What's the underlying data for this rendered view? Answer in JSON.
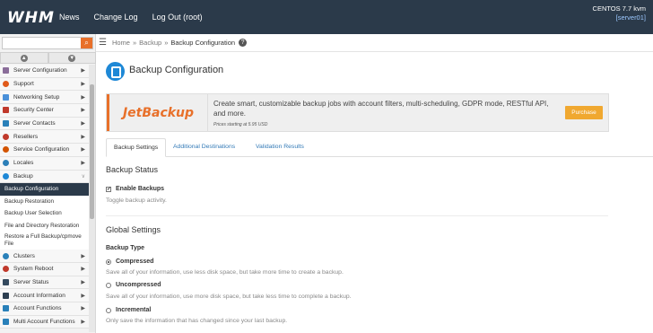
{
  "header": {
    "logo": "WHM",
    "nav": [
      "News",
      "Change Log",
      "Log Out (root)"
    ],
    "server_os": "CENTOS 7.7 kvm",
    "server_name": "[server01]"
  },
  "sidebar": {
    "search": {
      "value": "",
      "placeholder": ""
    },
    "menu": [
      {
        "label": "Server Configuration",
        "icon": "server-config-icon",
        "color": "#8a6d9a"
      },
      {
        "label": "Support",
        "icon": "support-icon",
        "color": "#e05a1a"
      },
      {
        "label": "Networking Setup",
        "icon": "network-icon",
        "color": "#4a90d9"
      },
      {
        "label": "Security Center",
        "icon": "security-icon",
        "color": "#c0392b"
      },
      {
        "label": "Server Contacts",
        "icon": "contacts-icon",
        "color": "#2980b9"
      },
      {
        "label": "Resellers",
        "icon": "resellers-icon",
        "color": "#c0392b"
      },
      {
        "label": "Service Configuration",
        "icon": "service-config-icon",
        "color": "#d35400"
      },
      {
        "label": "Locales",
        "icon": "locales-icon",
        "color": "#2c7fb8"
      },
      {
        "label": "Backup",
        "icon": "backup-icon",
        "color": "#1e88d6"
      }
    ],
    "backup_sub": [
      "Backup Configuration",
      "Backup Restoration",
      "Backup User Selection",
      "File and Directory Restoration",
      "Restore a Full Backup/cpmove File"
    ],
    "menu_after": [
      {
        "label": "Clusters",
        "icon": "clusters-icon",
        "color": "#2980b9"
      },
      {
        "label": "System Reboot",
        "icon": "reboot-icon",
        "color": "#c0392b"
      },
      {
        "label": "Server Status",
        "icon": "status-icon",
        "color": "#34495e"
      },
      {
        "label": "Account Information",
        "icon": "account-info-icon",
        "color": "#2c3e50"
      },
      {
        "label": "Account Functions",
        "icon": "account-functions-icon",
        "color": "#2980b9"
      },
      {
        "label": "Multi Account Functions",
        "icon": "multi-account-icon",
        "color": "#2980b9"
      }
    ]
  },
  "breadcrumb": {
    "home": "Home",
    "backup": "Backup",
    "current": "Backup Configuration",
    "help": "?"
  },
  "page": {
    "title": "Backup Configuration"
  },
  "promo": {
    "logo": "JetBackup",
    "text": "Create smart, customizable backup jobs with account filters, multi-scheduling, GDPR mode, RESTful API, and more.",
    "price": "Prices starting at 5.95 USD",
    "button": "Purchase"
  },
  "tabs": [
    "Backup Settings",
    "Additional Destinations",
    "Validation Results"
  ],
  "backup_status": {
    "title": "Backup Status",
    "checkbox_label": "Enable Backups",
    "checked": true,
    "help": "Toggle backup activity."
  },
  "global_settings": {
    "title": "Global Settings",
    "backup_type_label": "Backup Type",
    "options": [
      {
        "label": "Compressed",
        "selected": true,
        "help": "Save all of your information, use less disk space, but take more time to create a backup."
      },
      {
        "label": "Uncompressed",
        "selected": false,
        "help": "Save all of your information, use more disk space, but take less time to complete a backup."
      },
      {
        "label": "Incremental",
        "selected": false,
        "help": "Only save the information that has changed since your last backup."
      }
    ]
  },
  "colors": {
    "topbar": "#2b3a4a",
    "accent": "#e8702a",
    "link": "#337ab7",
    "purchase": "#f0a830"
  }
}
